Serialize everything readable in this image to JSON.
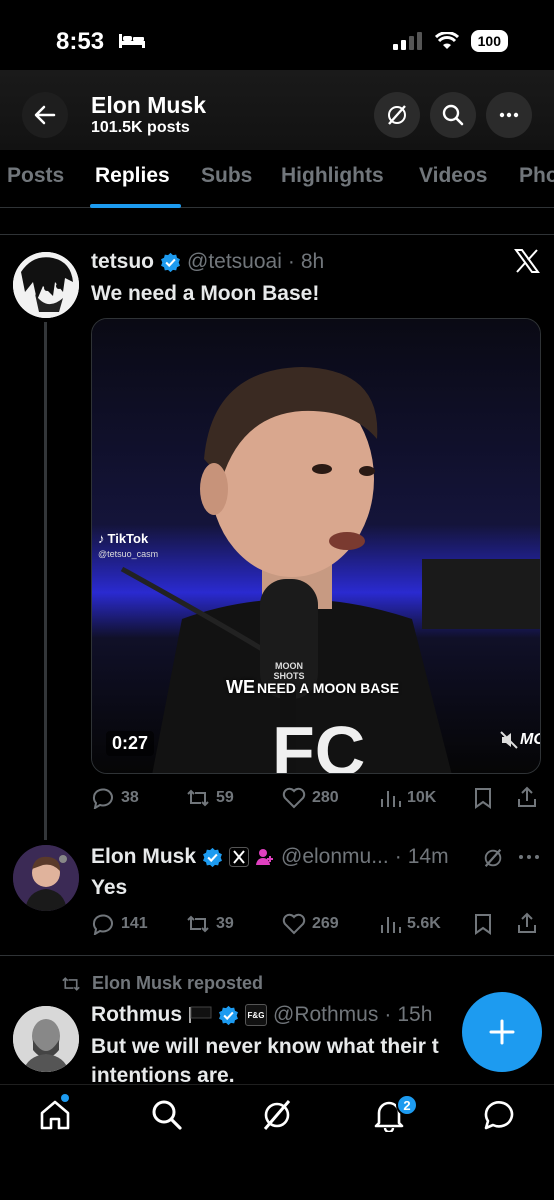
{
  "status_bar": {
    "time": "8:53",
    "battery": "100"
  },
  "header": {
    "title": "Elon Musk",
    "subtitle": "101.5K posts"
  },
  "tabs": [
    {
      "label": "Posts"
    },
    {
      "label": "Replies"
    },
    {
      "label": "Subs"
    },
    {
      "label": "Highlights"
    },
    {
      "label": "Videos"
    },
    {
      "label": "Pho"
    }
  ],
  "active_tab": "Replies",
  "tweet1": {
    "name": "tetsuo",
    "handle": "@tetsuoai",
    "time": "8h",
    "text": "We need a Moon Base!",
    "media": {
      "tiktok_label": "TikTok",
      "tiktok_user": "@tetsuo_casm",
      "caption_we": "WE",
      "caption_rest": "NEED A MOON BASE",
      "duration": "0:27",
      "mic_label_1": "MOON",
      "mic_label_2": "SHOTS",
      "shirt_text": "FC",
      "corner_text": "MO"
    },
    "stats": {
      "replies": "38",
      "reposts": "59",
      "likes": "280",
      "views": "10K"
    }
  },
  "tweet2": {
    "name": "Elon Musk",
    "handle": "@elonmu...",
    "time": "14m",
    "text": "Yes",
    "stats": {
      "replies": "141",
      "reposts": "39",
      "likes": "269",
      "views": "5.6K"
    }
  },
  "tweet3": {
    "repost_label": "Elon Musk reposted",
    "name": "Rothmus",
    "badge_text": "F&G",
    "handle": "@Rothmus",
    "time": "15h",
    "text_line1": "But we will never know what their t",
    "text_line2": "intentions are."
  },
  "bottom_nav": {
    "notifications_count": "2"
  },
  "colors": {
    "accent": "#1d9bf0",
    "background": "#000000",
    "muted": "#71767b"
  }
}
